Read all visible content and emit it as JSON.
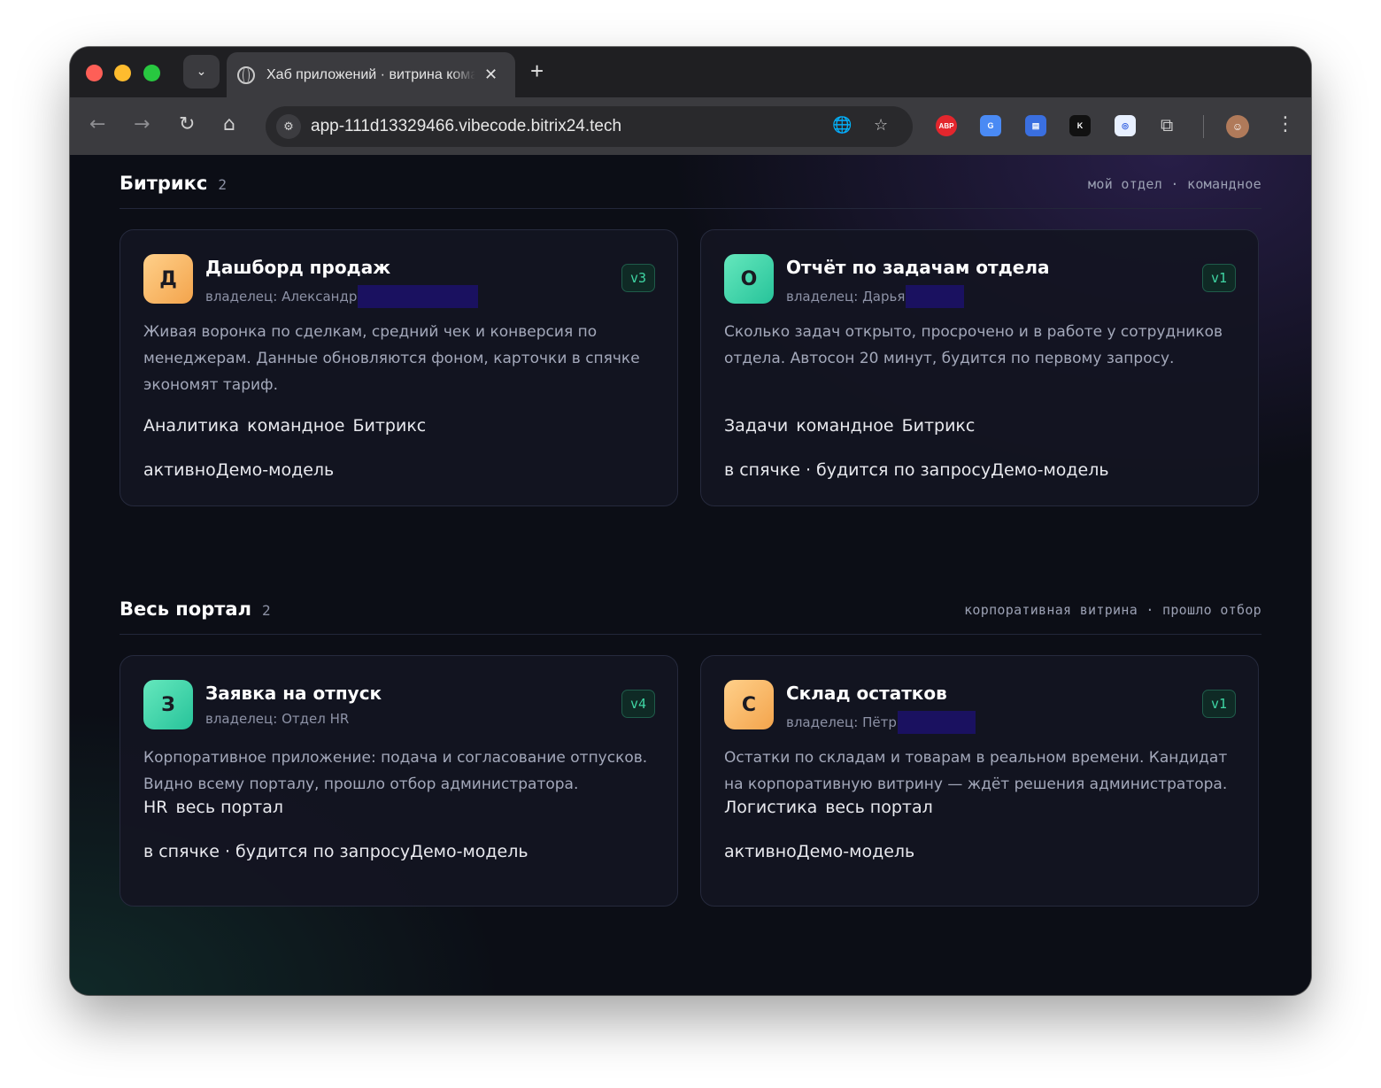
{
  "browser": {
    "tab_title": "Хаб приложений · витрина команды",
    "url": "app-111d13329466.vibecode.bitrix24.tech",
    "extensions": [
      {
        "name": "adblock-plus-icon",
        "label": "ABP",
        "bg": "#e3262d",
        "fg": "#ffffff"
      },
      {
        "name": "google-translate-icon",
        "label": "G",
        "bg": "#4a8af4",
        "fg": "#ffffff"
      },
      {
        "name": "google-docs-icon",
        "label": "▤",
        "bg": "#3a6fe0",
        "fg": "#ffffff"
      },
      {
        "name": "kontur-icon",
        "label": "K",
        "bg": "#111111",
        "fg": "#ffffff"
      },
      {
        "name": "target-extension-icon",
        "label": "◎",
        "bg": "#e8f0ff",
        "fg": "#2f5de0"
      }
    ]
  },
  "sections": [
    {
      "title": "Битрикс",
      "count": "2",
      "meta": "мой отдел · командное",
      "cards": [
        {
          "avatar_letter": "Д",
          "avatar_color": "orange",
          "title": "Дашборд продаж",
          "owner": "владелец: Александр",
          "version": "v3",
          "description": "Живая воронка по сделкам, средний чек и конверсия по менеджерам. Данные обновляются фоном, карточки в спячке экономят тариф.",
          "tags": [
            "Аналитика",
            "командное",
            "Битрикс"
          ],
          "status": "активноДемо-модель"
        },
        {
          "avatar_letter": "О",
          "avatar_color": "green",
          "title": "Отчёт по задачам отдела",
          "owner": "владелец: Дарья",
          "version": "v1",
          "description": "Сколько задач открыто, просрочено и в работе у сотрудников отдела. Автосон 20 минут, будится по первому запросу.",
          "tags": [
            "Задачи",
            "командное",
            "Битрикс"
          ],
          "status": "в спячке · будится по запросуДемо-модель"
        }
      ]
    },
    {
      "title": "Весь портал",
      "count": "2",
      "meta": "корпоративная витрина · прошло отбор",
      "cards": [
        {
          "avatar_letter": "З",
          "avatar_color": "green",
          "title": "Заявка на отпуск",
          "owner": "владелец: Отдел HR",
          "version": "v4",
          "description": "Корпоративное приложение: подача и согласование отпусков. Видно всему порталу, прошло отбор администратора.",
          "tags": [
            "HR",
            "весь портал"
          ],
          "status": "в спячке · будится по запросуДемо-модель"
        },
        {
          "avatar_letter": "С",
          "avatar_color": "orange",
          "title": "Склад остатков",
          "owner": "владелец: Пётр",
          "version": "v1",
          "description": "Остатки по складам и товарам в реальном времени. Кандидат на корпоративную витрину — ждёт решения администратора.",
          "tags": [
            "Логистика",
            "весь портал"
          ],
          "status": "активноДемо-модель"
        }
      ]
    }
  ]
}
